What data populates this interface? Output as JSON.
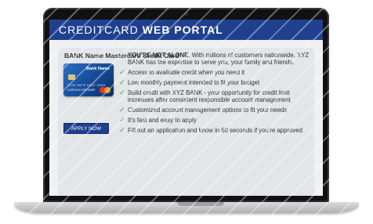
{
  "portal": {
    "title_light": "CREDITCARD",
    "title_bold": "WEB PORTAL"
  },
  "product": {
    "title": "BANK Name Mastercard Credit Card",
    "card": {
      "bank_name": "Bank Name",
      "number": "1234 5678 9012 3456",
      "holder": "CARDHOLDER NAME"
    },
    "apply_label": "APPLY NOW"
  },
  "features": [
    {
      "lead": "YOU'RE NOT ALONE",
      "text": ". With millions of customers nationwide, XYZ BANK has the expertise to serve you, your family and friends."
    },
    {
      "lead": "",
      "text": "Access to available credit when you need it"
    },
    {
      "lead": "",
      "text": "Low monthly payment intended to fit your budget"
    },
    {
      "lead": "",
      "text": "Build credit with XYZ BANK - your opportunity for credit limit increases after consistent responsible account management"
    },
    {
      "lead": "",
      "text": "Customized account management options to fit your needs"
    },
    {
      "lead": "",
      "text": "It's fast and easy to apply"
    },
    {
      "lead": "",
      "text": "Fill out an application and know in 60 seconds if you're approved"
    }
  ],
  "icons": {
    "check": "checkmark-icon"
  },
  "colors": {
    "header_bg": "#1f3f8f",
    "check": "#3aa63a",
    "panel_bg": "#e3e5e8"
  }
}
